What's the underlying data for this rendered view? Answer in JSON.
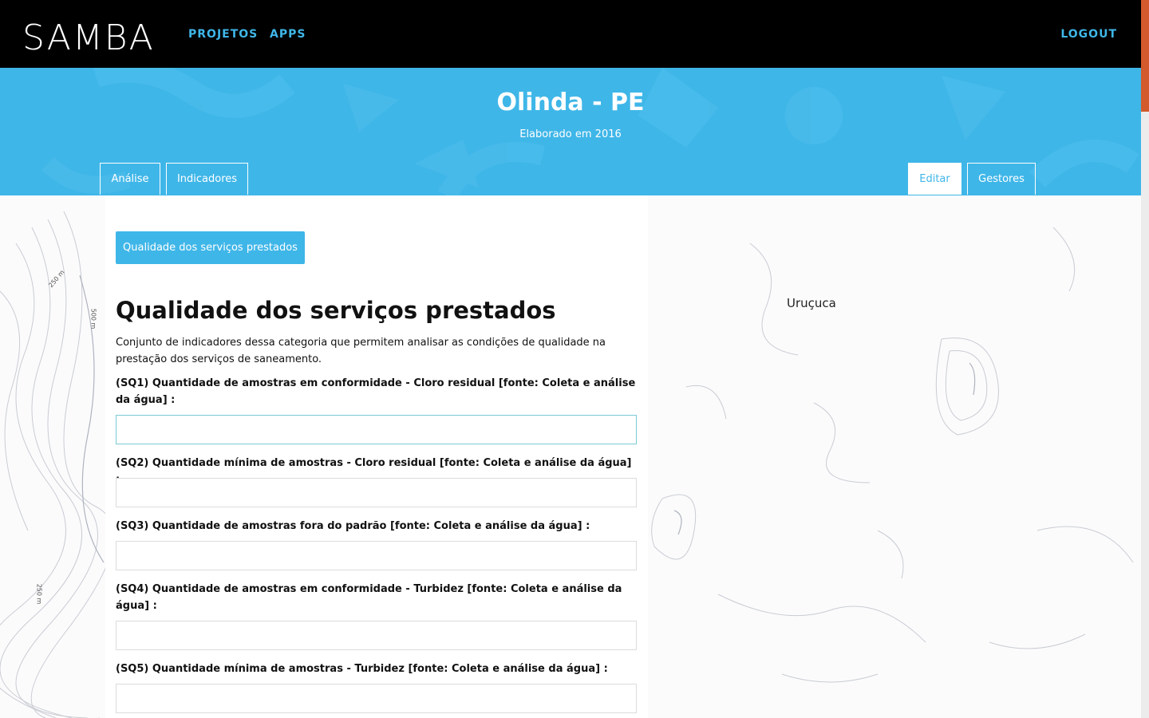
{
  "brand": {
    "logo_text": "SAMBA"
  },
  "nav": {
    "projetos": "PROJETOS",
    "apps": "APPS",
    "logout": "LOGOUT"
  },
  "header": {
    "title": "Olinda - PE",
    "subtitle": "Elaborado em 2016",
    "tabs_left": [
      "Análise",
      "Indicadores"
    ],
    "tabs_right": [
      "Editar",
      "Gestores"
    ]
  },
  "map": {
    "place_label": "Uruçuca",
    "contour_labels": [
      "250 m",
      "500 m",
      "250 m"
    ]
  },
  "category_chip": "Qualidade dos serviços prestados",
  "section": {
    "title": "Qualidade dos serviços prestados",
    "description": "Conjunto de indicadores dessa categoria que permitem analisar as condições de qualidade na prestação dos serviços de saneamento."
  },
  "questions": [
    {
      "label": "(SQ1) Quantidade de amostras em conformidade - Cloro residual [fonte: Coleta e análise da água] :",
      "value": ""
    },
    {
      "label": "(SQ2) Quantidade mínima de amostras - Cloro residual [fonte: Coleta e análise da água] :",
      "value": ""
    },
    {
      "label": "(SQ3) Quantidade de amostras fora do padrão [fonte: Coleta e análise da água] :",
      "value": ""
    },
    {
      "label": "(SQ4) Quantidade de amostras em conformidade - Turbidez [fonte: Coleta e análise da água] :",
      "value": ""
    },
    {
      "label": "(SQ5) Quantidade mínima de amostras - Turbidez [fonte: Coleta e análise da água] :",
      "value": ""
    }
  ],
  "colors": {
    "accent": "#3fb6e8",
    "topbar": "#000000",
    "scroll_thumb": "#d35a2c"
  }
}
